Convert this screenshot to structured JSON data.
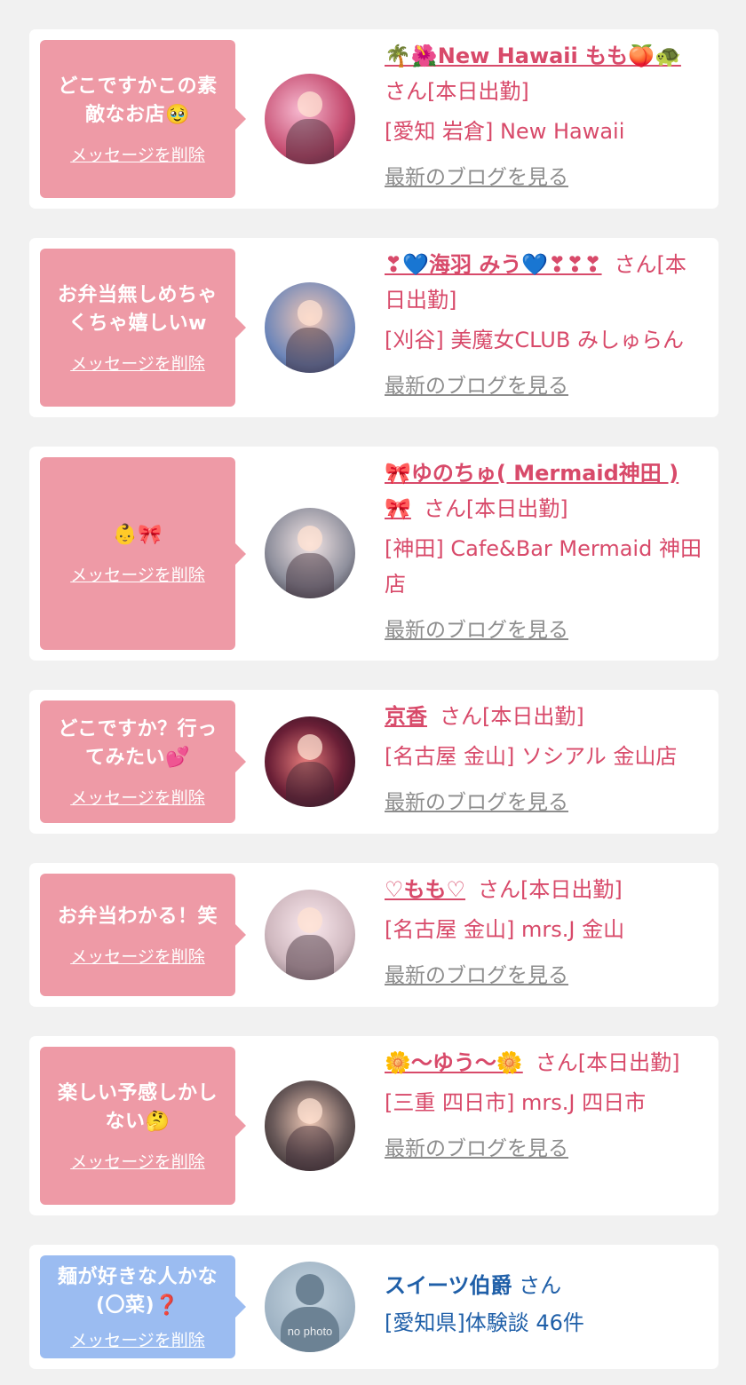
{
  "messages": [
    {
      "text": "どこですかこの素敵なお店🥹",
      "delete_label": "メッセージを削除",
      "name": "🌴🌺New Hawaii もも🍑🐢",
      "suffix": "さん[本日出勤]",
      "shop": "[愛知 岩倉] New Hawaii",
      "blog_label": "最新のブログを見る"
    },
    {
      "text": "お弁当無しめちゃくちゃ嬉しいw",
      "delete_label": "メッセージを削除",
      "name": "❣💙海羽 みう💙❣❣❣",
      "suffix": "さん[本日出勤]",
      "shop": "[刈谷] 美魔女CLUB みしゅらん",
      "blog_label": "最新のブログを見る"
    },
    {
      "text": "👶🎀",
      "delete_label": "メッセージを削除",
      "name": "🎀ゆのちゅ( Mermaid神田 )🎀",
      "suffix": "さん[本日出勤]",
      "shop": "[神田] Cafe&Bar Mermaid 神田店",
      "blog_label": "最新のブログを見る"
    },
    {
      "text": "どこですか？行ってみたい💕",
      "delete_label": "メッセージを削除",
      "name": "京香",
      "suffix": "さん[本日出勤]",
      "shop": "[名古屋 金山] ソシアル 金山店",
      "blog_label": "最新のブログを見る"
    },
    {
      "text": "お弁当わかる！笑",
      "delete_label": "メッセージを削除",
      "name": "♡もも♡",
      "suffix": "さん[本日出勤]",
      "shop": "[名古屋 金山] mrs.J 金山",
      "blog_label": "最新のブログを見る"
    },
    {
      "text": "楽しい予感しかしない🤔",
      "delete_label": "メッセージを削除",
      "name": "🌼〜ゆう〜🌼",
      "suffix": "さん[本日出勤]",
      "shop": "[三重 四日市] mrs.J 四日市",
      "blog_label": "最新のブログを見る"
    },
    {
      "text": "麺が好きな人かな(〇菜)❓",
      "delete_label": "メッセージを削除",
      "name": "スイーツ伯爵",
      "suffix": "さん",
      "shop": "[愛知県]体験談 46件",
      "photo_placeholder": "no photo"
    }
  ],
  "colors": {
    "pink_bubble": "#ee9aa6",
    "blue_bubble": "#9bbcf1",
    "name_pink": "#d84a6a",
    "name_blue": "#1f5fa8",
    "link_gray": "#8d8d8d"
  }
}
